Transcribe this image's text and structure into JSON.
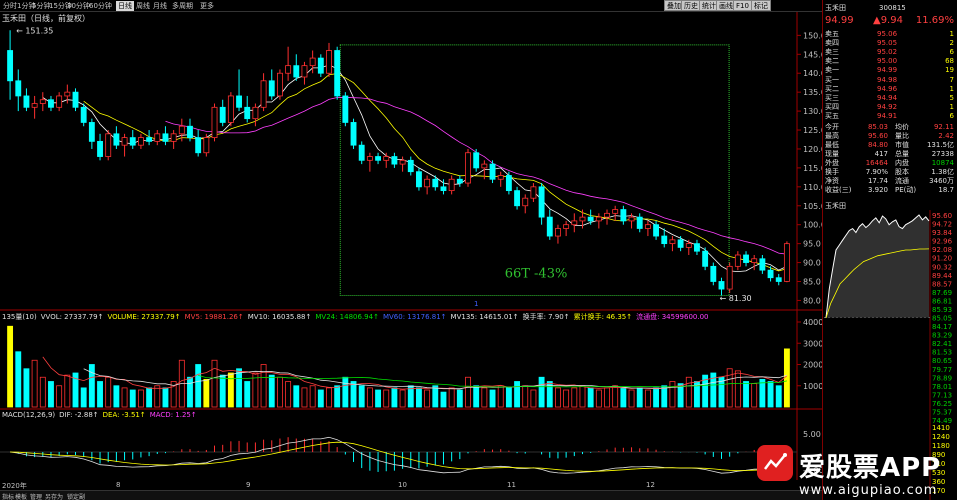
{
  "toolbar": {
    "periods": [
      "分时",
      "1分钟",
      "5分钟",
      "15分钟",
      "30分钟",
      "60分钟",
      "日线",
      "周线",
      "月线",
      "多周期",
      "更多"
    ],
    "active_index": 6,
    "right_buttons": [
      "叠加",
      "历史",
      "统计",
      "画线",
      "F10",
      "标记"
    ]
  },
  "chart": {
    "title": "玉禾田（日线，前复权）",
    "high_label": "151.35",
    "low_label": "81.30",
    "annotation": "66T -43%",
    "y_ticks": [
      "150.0",
      "145.0",
      "140.0",
      "135.0",
      "130.0",
      "125.0",
      "120.0",
      "115.0",
      "110.0",
      "105.0",
      "100.0",
      "95.0",
      "90.0",
      "85.0",
      "80.0"
    ],
    "vol_ticks": [
      "40000",
      "30000",
      "20000",
      "10000"
    ],
    "macd_ticks": [
      "5.00",
      "-5.00"
    ],
    "months": [
      "2020年",
      "8",
      "9",
      "10",
      "11",
      "12"
    ],
    "year_marker": "1"
  },
  "volume": {
    "label": "135量(10)",
    "items": [
      {
        "k": "VVOL:",
        "v": "27337.79↑",
        "c": "#e0e0e0"
      },
      {
        "k": "VOLUME:",
        "v": "27337.79↑",
        "c": "#ffff00"
      },
      {
        "k": "MV5:",
        "v": "19881.26↑",
        "c": "#ff4040"
      },
      {
        "k": "MV10:",
        "v": "16035.88↑",
        "c": "#e0e0e0"
      },
      {
        "k": "MV24:",
        "v": "14806.94↑",
        "c": "#00e000"
      },
      {
        "k": "MV60:",
        "v": "13176.81↑",
        "c": "#4060ff"
      },
      {
        "k": "MV135:",
        "v": "14615.01↑",
        "c": "#e0e0e0"
      },
      {
        "k": "换手率:",
        "v": "7.90↑",
        "c": "#e0e0e0"
      },
      {
        "k": "累计换手:",
        "v": "46.35↑",
        "c": "#ffff00"
      },
      {
        "k": "流通盘:",
        "v": "34599600.00",
        "c": "#ff40ff"
      }
    ]
  },
  "macd": {
    "label": "MACD(12,26,9)",
    "items": [
      {
        "k": "DIF:",
        "v": "-2.88↑",
        "c": "#e0e0e0"
      },
      {
        "k": "DEA:",
        "v": "-3.51↑",
        "c": "#ffff00"
      },
      {
        "k": "MACD:",
        "v": "1.25↑",
        "c": "#ff40ff"
      }
    ]
  },
  "bottom_tabs": [
    "指标",
    "模板",
    "管理",
    "另存为",
    "锁定副"
  ],
  "quote": {
    "name": "玉禾田",
    "code": "300815",
    "last": "94.99",
    "change": "▲9.94",
    "pct": "11.69%",
    "asks": [
      {
        "l": "卖五",
        "p": "95.06",
        "v": "1"
      },
      {
        "l": "卖四",
        "p": "95.05",
        "v": "2"
      },
      {
        "l": "卖三",
        "p": "95.02",
        "v": "6"
      },
      {
        "l": "卖二",
        "p": "95.00",
        "v": "68"
      },
      {
        "l": "卖一",
        "p": "94.99",
        "v": "19"
      }
    ],
    "bids": [
      {
        "l": "买一",
        "p": "94.98",
        "v": "7"
      },
      {
        "l": "买二",
        "p": "94.96",
        "v": "1"
      },
      {
        "l": "买三",
        "p": "94.94",
        "v": "5"
      },
      {
        "l": "买四",
        "p": "94.92",
        "v": "1"
      },
      {
        "l": "买五",
        "p": "94.91",
        "v": "6"
      }
    ],
    "stats": [
      {
        "a": "今开",
        "b": "85.03",
        "c": "均价",
        "d": "92.11",
        "bc": "red",
        "dc": "red"
      },
      {
        "a": "最高",
        "b": "95.60",
        "c": "量比",
        "d": "2.42",
        "bc": "red",
        "dc": "red"
      },
      {
        "a": "最低",
        "b": "84.80",
        "c": "市值",
        "d": "131.5亿",
        "bc": "red",
        "dc": "white"
      },
      {
        "a": "现量",
        "b": "417",
        "c": "总量",
        "d": "27338",
        "bc": "white",
        "dc": "white"
      },
      {
        "a": "外盘",
        "b": "16464",
        "c": "内盘",
        "d": "10874",
        "bc": "red",
        "dc": "green"
      },
      {
        "a": "换手",
        "b": "7.90%",
        "c": "股本",
        "d": "1.38亿",
        "bc": "white",
        "dc": "white"
      },
      {
        "a": "净资",
        "b": "17.74",
        "c": "流通",
        "d": "3460万",
        "bc": "white",
        "dc": "white"
      },
      {
        "a": "收益(三)",
        "b": "3.920",
        "c": "PE(动)",
        "d": "18.7",
        "bc": "white",
        "dc": "white"
      }
    ],
    "mini_title": "玉禾田",
    "mini_ticks": [
      "95.60",
      "94.72",
      "93.84",
      "92.96",
      "92.08",
      "91.20",
      "90.32",
      "89.44",
      "88.57",
      "87.69",
      "86.81",
      "85.93",
      "85.05",
      "84.17",
      "83.29",
      "82.41",
      "81.53",
      "80.65",
      "79.77",
      "78.89",
      "78.01",
      "77.13",
      "76.25",
      "75.37",
      "74.49"
    ],
    "mini_vol": [
      "1410",
      "1240",
      "1180",
      "890",
      "710",
      "530",
      "360",
      "170"
    ]
  },
  "watermark": {
    "brand": "爱股票APP",
    "url": "www.aigupiao.com",
    "logo_text": "爱股票"
  },
  "colors": {
    "up": "#ff3030",
    "down": "#00ffff",
    "ma5": "#ffffff",
    "ma10": "#ffff00",
    "ma20": "#ff40ff",
    "box": "#30c030"
  },
  "candles": [
    [
      146,
      151.35,
      133,
      138
    ],
    [
      138,
      141,
      130,
      134
    ],
    [
      134,
      136,
      130,
      131
    ],
    [
      131,
      134,
      128,
      132
    ],
    [
      132,
      135,
      130,
      133
    ],
    [
      133,
      134,
      130,
      131
    ],
    [
      131,
      135,
      130,
      134
    ],
    [
      134,
      137,
      132,
      135
    ],
    [
      135,
      136,
      130,
      131
    ],
    [
      131,
      132,
      126,
      127
    ],
    [
      127,
      128,
      120,
      122
    ],
    [
      122,
      124,
      117,
      118
    ],
    [
      118,
      125,
      117,
      124
    ],
    [
      124,
      126,
      120,
      121
    ],
    [
      121,
      124,
      118,
      123
    ],
    [
      123,
      125,
      120,
      121
    ],
    [
      121,
      124,
      120,
      123
    ],
    [
      123,
      125,
      121,
      122
    ],
    [
      122,
      125,
      121,
      124
    ],
    [
      124,
      126,
      121,
      122
    ],
    [
      122,
      125,
      120,
      124
    ],
    [
      124,
      128,
      122,
      126
    ],
    [
      126,
      128,
      122,
      123
    ],
    [
      123,
      125,
      118,
      119
    ],
    [
      119,
      124,
      118,
      123
    ],
    [
      123,
      132,
      122,
      131
    ],
    [
      131,
      133,
      126,
      127
    ],
    [
      127,
      135,
      126,
      134
    ],
    [
      134,
      141,
      130,
      131
    ],
    [
      131,
      134,
      127,
      128
    ],
    [
      128,
      132,
      126,
      131
    ],
    [
      131,
      140,
      130,
      138
    ],
    [
      138,
      141,
      133,
      134
    ],
    [
      134,
      141,
      133,
      140
    ],
    [
      140,
      147,
      138,
      142
    ],
    [
      142,
      145,
      138,
      139
    ],
    [
      139,
      143,
      137,
      142
    ],
    [
      142,
      146,
      140,
      144
    ],
    [
      144,
      145,
      139,
      140
    ],
    [
      140,
      148,
      139,
      146
    ],
    [
      146,
      147,
      133,
      134
    ],
    [
      134,
      135,
      126,
      127
    ],
    [
      127,
      128,
      120,
      121
    ],
    [
      121,
      122,
      116,
      117
    ],
    [
      117,
      119,
      114,
      118
    ],
    [
      118,
      119,
      116,
      117
    ],
    [
      117,
      119,
      115,
      118
    ],
    [
      118,
      119,
      115,
      116
    ],
    [
      116,
      118,
      114,
      117
    ],
    [
      117,
      118,
      113,
      114
    ],
    [
      114,
      115,
      109,
      110
    ],
    [
      110,
      113,
      108,
      112
    ],
    [
      112,
      113,
      109,
      110
    ],
    [
      110,
      112,
      108,
      109
    ],
    [
      109,
      113,
      108,
      112
    ],
    [
      112,
      113,
      110,
      111
    ],
    [
      111,
      120,
      110,
      119
    ],
    [
      119,
      120,
      114,
      115
    ],
    [
      115,
      117,
      112,
      116
    ],
    [
      116,
      117,
      111,
      112
    ],
    [
      112,
      114,
      110,
      113
    ],
    [
      113,
      114,
      108,
      109
    ],
    [
      109,
      110,
      104,
      105
    ],
    [
      105,
      108,
      103,
      107
    ],
    [
      107,
      111,
      106,
      110
    ],
    [
      110,
      111,
      100,
      102
    ],
    [
      102,
      104,
      96,
      97
    ],
    [
      97,
      100,
      95,
      99
    ],
    [
      99,
      101,
      97,
      100
    ],
    [
      100,
      103,
      98,
      101
    ],
    [
      101,
      104,
      99,
      102
    ],
    [
      102,
      104,
      100,
      101
    ],
    [
      101,
      103,
      99,
      102
    ],
    [
      102,
      104,
      100,
      103
    ],
    [
      103,
      105,
      101,
      104
    ],
    [
      104,
      105,
      100,
      101
    ],
    [
      101,
      103,
      99,
      102
    ],
    [
      102,
      103,
      98,
      99
    ],
    [
      99,
      101,
      97,
      100
    ],
    [
      100,
      101,
      96,
      97
    ],
    [
      97,
      99,
      94,
      95
    ],
    [
      95,
      97,
      93,
      96
    ],
    [
      96,
      97,
      93,
      94
    ],
    [
      94,
      96,
      92,
      95
    ],
    [
      95,
      96,
      92,
      93
    ],
    [
      93,
      94,
      88,
      89
    ],
    [
      89,
      90,
      84,
      85
    ],
    [
      85,
      86,
      81.3,
      83
    ],
    [
      83,
      90,
      82,
      89
    ],
    [
      89,
      93,
      88,
      92
    ],
    [
      92,
      93,
      89,
      90
    ],
    [
      90,
      92,
      88,
      91
    ],
    [
      91,
      92,
      87,
      88
    ],
    [
      88,
      89,
      85,
      86
    ],
    [
      86,
      87,
      84,
      85
    ],
    [
      85.03,
      95.6,
      84.8,
      94.99
    ]
  ],
  "volumes": [
    38000,
    26000,
    18000,
    22000,
    14000,
    12000,
    10000,
    15000,
    16000,
    9000,
    20000,
    12000,
    14000,
    10000,
    9000,
    8000,
    8000,
    9000,
    10000,
    9000,
    12000,
    22000,
    14000,
    20000,
    13000,
    22000,
    15000,
    16000,
    18000,
    12000,
    16000,
    20000,
    15000,
    14000,
    12000,
    10000,
    9000,
    10000,
    8000,
    9000,
    10000,
    14000,
    12000,
    10000,
    9000,
    8000,
    8000,
    9000,
    8000,
    10000,
    9000,
    8000,
    10000,
    7000,
    9000,
    8000,
    14000,
    10000,
    9000,
    8000,
    10000,
    9000,
    12000,
    10000,
    8000,
    14000,
    12000,
    9000,
    8000,
    9000,
    10000,
    9000,
    8000,
    9000,
    10000,
    9000,
    8000,
    9000,
    8000,
    9000,
    10000,
    12000,
    11000,
    14000,
    12000,
    15000,
    16000,
    14000,
    18000,
    17000,
    12000,
    11000,
    13000,
    12000,
    10000,
    27338
  ]
}
